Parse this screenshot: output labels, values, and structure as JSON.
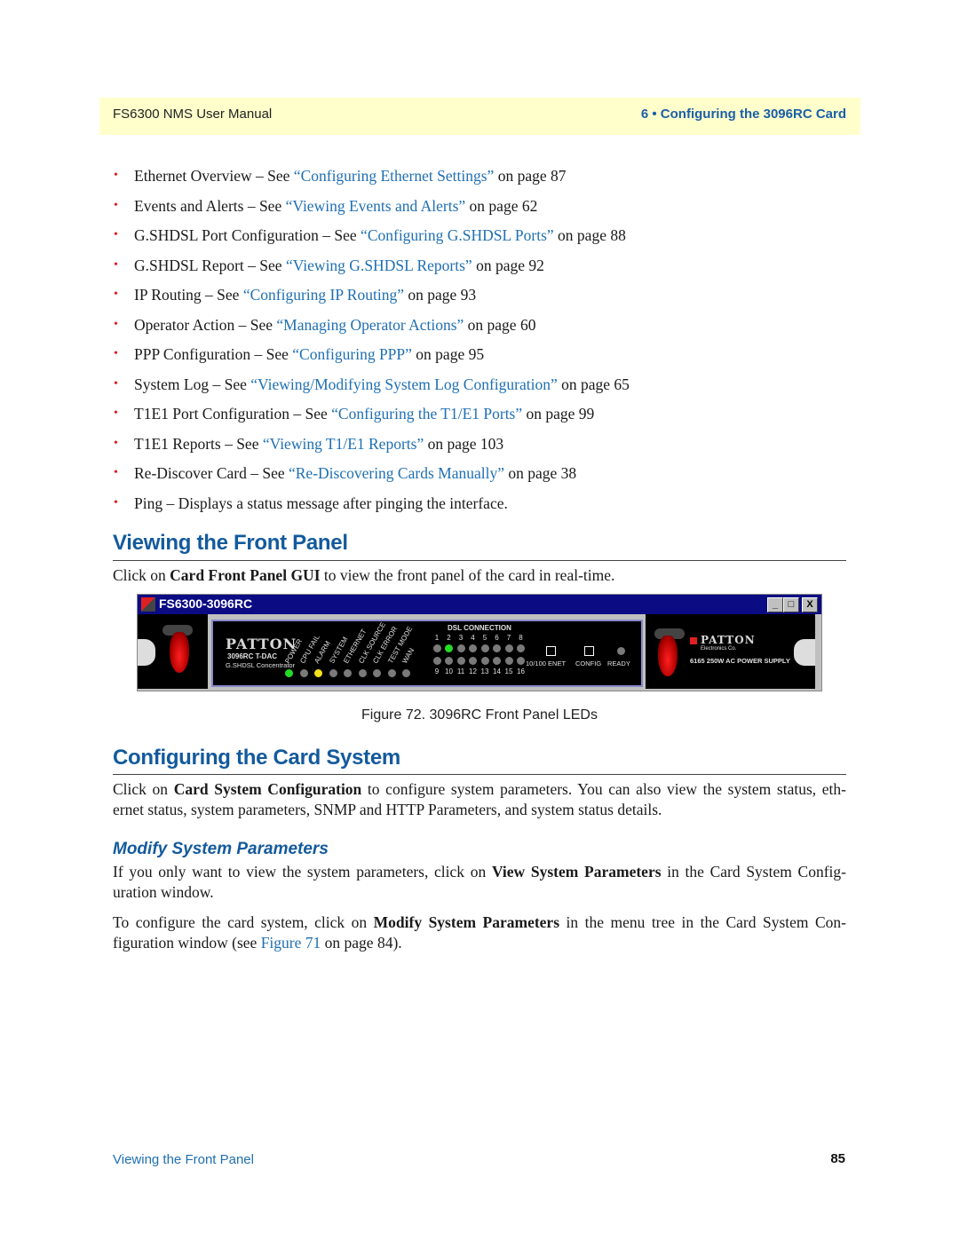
{
  "header": {
    "manual_title": "FS6300 NMS User Manual",
    "chapter": "6 • Configuring the 3096RC Card"
  },
  "bullets": [
    {
      "prefix": "Ethernet Overview – See ",
      "link": "“Configuring Ethernet Settings”",
      "suffix": " on page 87"
    },
    {
      "prefix": "Events and Alerts – See ",
      "link": "“Viewing Events and Alerts”",
      "suffix": " on page 62"
    },
    {
      "prefix": "G.SHDSL Port Configuration – See ",
      "link": "“Configuring G.SHDSL Ports”",
      "suffix": " on page 88"
    },
    {
      "prefix": "G.SHDSL Report – See ",
      "link": "“Viewing G.SHDSL Reports”",
      "suffix": " on page 92"
    },
    {
      "prefix": "IP Routing – See ",
      "link": "“Configuring IP Routing”",
      "suffix": " on page 93"
    },
    {
      "prefix": "Operator Action – See ",
      "link": "“Managing Operator Actions”",
      "suffix": " on page 60"
    },
    {
      "prefix": "PPP Configuration – See ",
      "link": "“Configuring PPP”",
      "suffix": " on page 95"
    },
    {
      "prefix": "System Log – See ",
      "link": "“Viewing/Modifying System Log Configuration”",
      "suffix": " on page 65"
    },
    {
      "prefix": "T1E1 Port Configuration – See ",
      "link": "“Configuring the T1/E1 Ports”",
      "suffix": " on page 99"
    },
    {
      "prefix": "T1E1 Reports – See ",
      "link": "“Viewing T1/E1 Reports”",
      "suffix": " on page 103"
    },
    {
      "prefix": "Re-Discover Card – See ",
      "link": "“Re-Discovering Cards Manually”",
      "suffix": " on page 38"
    },
    {
      "prefix": "Ping – Displays a status message after pinging the interface.",
      "link": "",
      "suffix": ""
    }
  ],
  "section1": {
    "title": "Viewing the Front Panel",
    "para_pre": "Click on ",
    "para_bold": "Card Front Panel GUI",
    "para_post": " to view the front panel of the card in real-time."
  },
  "figure": {
    "window_title": "FS6300-3096RC",
    "buttons": {
      "minimize": "_",
      "maximize": "□",
      "close": "X"
    },
    "brand": "PATTON",
    "model": "3096RC T-DAC",
    "subtitle": "G.SHDSL Concentrator",
    "status_leds": [
      {
        "label": "POWER",
        "color": "#22dd22"
      },
      {
        "label": "CPU FAIL",
        "color": "#7a7a7a"
      },
      {
        "label": "ALARM",
        "color": "#f2e21c"
      },
      {
        "label": "SYSTEM",
        "color": "#7a7a7a"
      },
      {
        "label": "ETHERNET",
        "color": "#7a7a7a"
      },
      {
        "label": "CLK SOURCE",
        "color": "#7a7a7a"
      },
      {
        "label": "CLK ERROR",
        "color": "#7a7a7a"
      },
      {
        "label": "TEST MODE",
        "color": "#7a7a7a"
      },
      {
        "label": "WAN",
        "color": "#7a7a7a"
      }
    ],
    "dsl_title": "DSL CONNECTION",
    "dsl_top_numbers": [
      "1",
      "2",
      "3",
      "4",
      "5",
      "6",
      "7",
      "8"
    ],
    "dsl_bottom_numbers": [
      "9",
      "10",
      "11",
      "12",
      "13",
      "14",
      "15",
      "16"
    ],
    "dsl_active_ports": [
      "2"
    ],
    "port_labels": {
      "enet": "10/100 ENET",
      "config": "CONFIG",
      "ready": "READY"
    },
    "psu_brand": "PATTON",
    "psu_brand_sub": "Electronics Co.",
    "psu_label": "6165 250W AC POWER SUPPLY",
    "caption": "Figure 72. 3096RC Front Panel LEDs"
  },
  "section2": {
    "title": "Configuring the Card System",
    "para_pre": "Click on ",
    "para_bold": "Card System Configuration",
    "para_post": " to configure system parameters. You can also view the system status, eth- ernet status, system parameters, SNMP and HTTP Parameters, and system status details."
  },
  "subsection": {
    "title": "Modify System Parameters",
    "p1_pre": "If you only want to view the system parameters, click on ",
    "p1_bold": "View System Parameters",
    "p1_post": " in the Card System Config- uration window.",
    "p2_pre": "To configure the card system, click on ",
    "p2_bold": "Modify System Parameters",
    "p2_post1": " in the menu tree in the Card System Con- figuration window (see ",
    "p2_link": "Figure 71",
    "p2_post2": " on page 84)."
  },
  "footer": {
    "section": "Viewing the Front Panel",
    "page": "85"
  }
}
